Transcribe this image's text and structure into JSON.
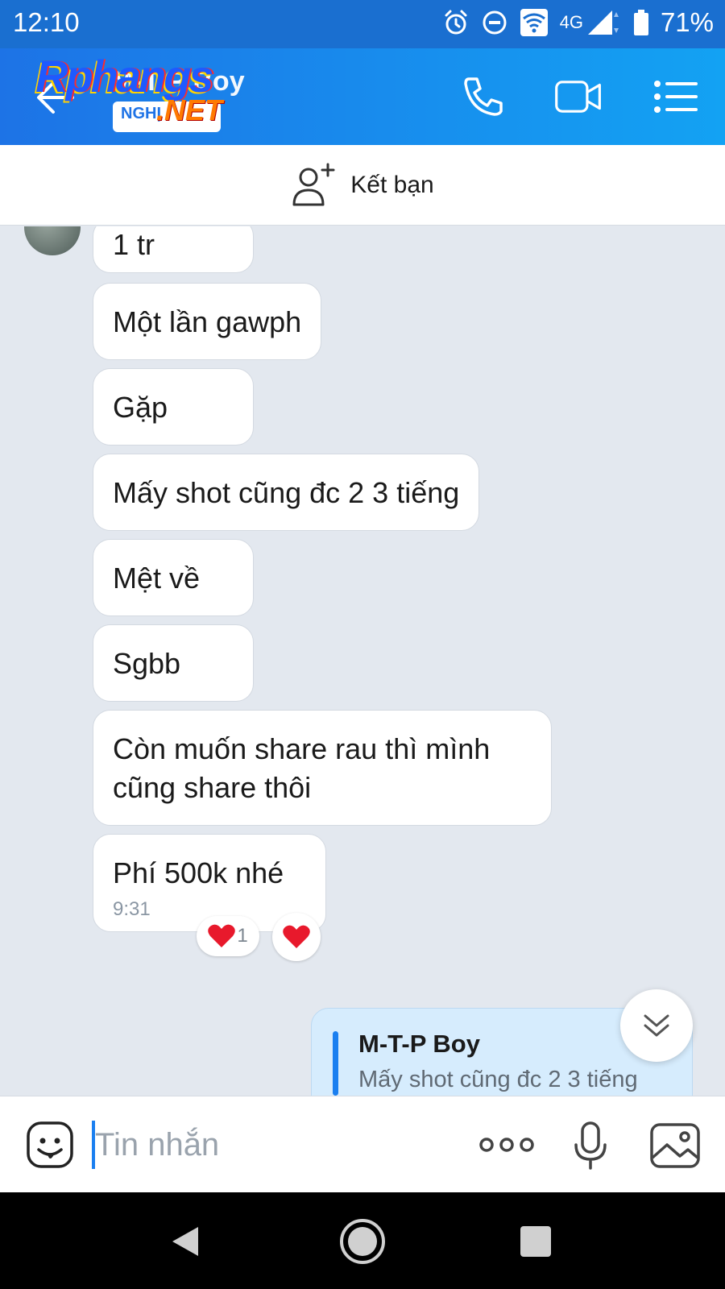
{
  "status_bar": {
    "time": "12:10",
    "network": "4G",
    "battery": "71%"
  },
  "header": {
    "contact_name": "M-T-P Boy",
    "watermark": {
      "main": "Rphangs",
      "net": ".NET",
      "sub": "NGHỊ"
    }
  },
  "friend_bar": {
    "label": "Kết bạn"
  },
  "messages": [
    {
      "text": "1 tr"
    },
    {
      "text": "Một lần gawph"
    },
    {
      "text": "Gặp"
    },
    {
      "text": "Mấy shot cũng đc 2 3 tiếng"
    },
    {
      "text": "Mệt về"
    },
    {
      "text": "Sgbb"
    },
    {
      "text": "Còn muốn share rau thì mình cũng share thôi"
    },
    {
      "text": "Phí 500k nhé",
      "time": "9:31"
    }
  ],
  "reactions": {
    "heart_count": "1"
  },
  "quoted_reply": {
    "name": "M-T-P Boy",
    "text": "Mấy shot cũng đc 2 3 tiếng"
  },
  "input_bar": {
    "placeholder": "Tin nhắn"
  },
  "colors": {
    "header_start": "#1d73e6",
    "header_end": "#13a2f3",
    "chat_bg": "#e3e8ef",
    "accent": "#1a7ff0",
    "heart": "#e8192c"
  }
}
